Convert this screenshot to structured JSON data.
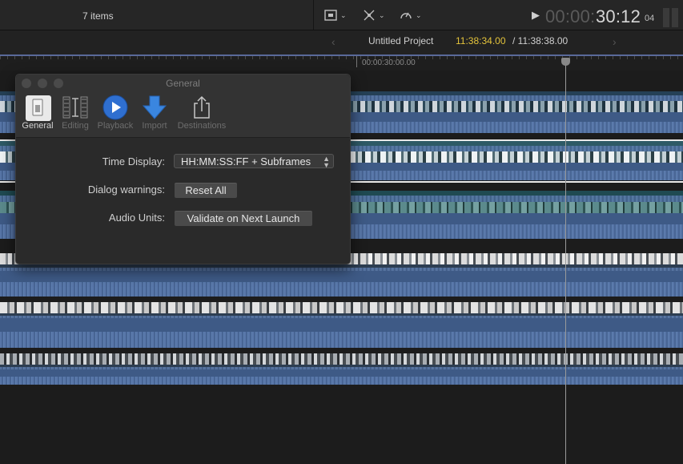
{
  "topbar": {
    "items_count": "7 items",
    "icons": [
      "clip-appearance-icon",
      "skimming-tools-icon",
      "retiming-icon"
    ],
    "timecode_dim": "00:00:",
    "timecode_main": "30:12",
    "timecode_sub": "04"
  },
  "project": {
    "name": "Untitled Project",
    "current_time": "11:38:34.00",
    "separator": " / ",
    "total_time": "11:38:38.00"
  },
  "ruler": {
    "label": "00:00:30:00.00"
  },
  "dialog": {
    "title": "General",
    "tabs": [
      {
        "label": "General",
        "icon": "switch-icon",
        "active": true
      },
      {
        "label": "Editing",
        "icon": "film-strip-icon",
        "active": false
      },
      {
        "label": "Playback",
        "icon": "play-circle-icon",
        "active": false
      },
      {
        "label": "Import",
        "icon": "down-arrow-icon",
        "active": false
      },
      {
        "label": "Destinations",
        "icon": "share-icon",
        "active": false
      }
    ],
    "time_display_label": "Time Display:",
    "time_display_value": "HH:MM:SS:FF + Subframes",
    "dialog_warnings_label": "Dialog warnings:",
    "reset_all_label": "Reset All",
    "audio_units_label": "Audio Units:",
    "validate_label": "Validate on Next Launch"
  },
  "colors": {
    "accent_timecode": "#e3c33b",
    "waveform": "#3e5a86",
    "playback_blue": "#3a7bd5"
  }
}
